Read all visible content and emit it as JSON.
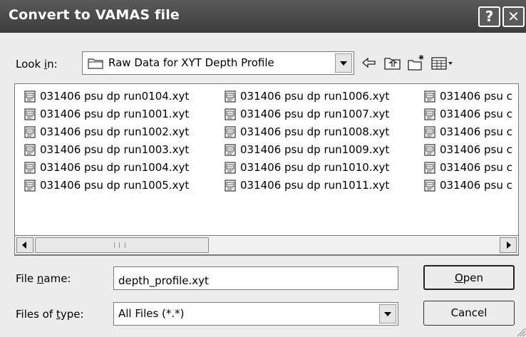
{
  "window": {
    "title": "Convert to VAMAS file",
    "help_label": "?",
    "close_label": "✕"
  },
  "lookin": {
    "label_pre": "Look ",
    "label_accel": "i",
    "label_post": "n:",
    "value": "Raw Data for XYT Depth Profile"
  },
  "files": {
    "col0": [
      "031406 psu dp run0104.xyt",
      "031406 psu dp run1001.xyt",
      "031406 psu dp run1002.xyt",
      "031406 psu dp run1003.xyt",
      "031406 psu dp run1004.xyt",
      "031406 psu dp run1005.xyt"
    ],
    "col1": [
      "031406 psu dp run1006.xyt",
      "031406 psu dp run1007.xyt",
      "031406 psu dp run1008.xyt",
      "031406 psu dp run1009.xyt",
      "031406 psu dp run1010.xyt",
      "031406 psu dp run1011.xyt"
    ],
    "col2": [
      "031406 psu c",
      "031406 psu c",
      "031406 psu c",
      "031406 psu c",
      "031406 psu c",
      "031406 psu c"
    ]
  },
  "filename": {
    "label_pre": "File ",
    "label_accel": "n",
    "label_post": "ame:",
    "value": "depth_profile.xyt"
  },
  "filetype": {
    "label_pre": "Files of ",
    "label_accel": "t",
    "label_post": "ype:",
    "value": "All Files (*.*)"
  },
  "buttons": {
    "open_accel": "O",
    "open_rest": "pen",
    "cancel": "Cancel"
  },
  "icons": {
    "file_icon": "document-icon",
    "folder_icon": "folder-icon",
    "back_icon": "back-arrow-icon",
    "up_icon": "up-one-level-icon",
    "new_folder_icon": "new-folder-icon",
    "views_icon": "views-menu-icon"
  }
}
